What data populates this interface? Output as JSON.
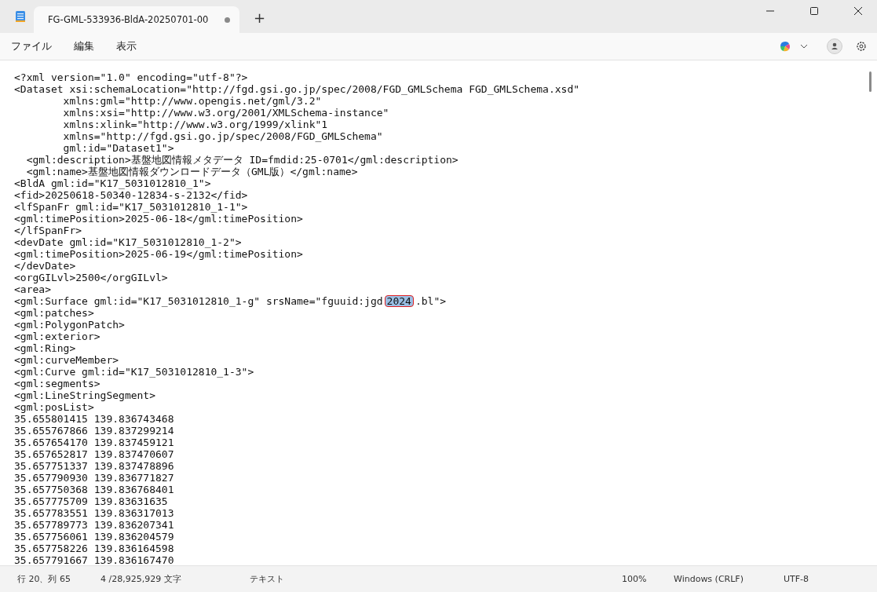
{
  "tab": {
    "title": "FG-GML-533936-BldA-20250701-00",
    "modified": true,
    "new_tab": "+"
  },
  "menu": [
    "ファイル",
    "編集",
    "表示"
  ],
  "lines": [
    {
      "kind": "plain",
      "text": "<?xml version=\"1.0\" encoding=\"utf-8\"?>"
    },
    {
      "kind": "plain",
      "text": "<Dataset xsi:schemaLocation=\"http://fgd.gsi.go.jp/spec/2008/FGD_GMLSchema FGD_GMLSchema.xsd\""
    },
    {
      "kind": "plain",
      "text": "        xmlns:gml=\"http://www.opengis.net/gml/3.2\""
    },
    {
      "kind": "plain",
      "text": "        xmlns:xsi=\"http://www.w3.org/2001/XMLSchema-instance\""
    },
    {
      "kind": "plain",
      "text": "        xmlns:xlink=\"http://www.w3.org/1999/xlink\"1"
    },
    {
      "kind": "plain",
      "text": "        xmlns=\"http://fgd.gsi.go.jp/spec/2008/FGD_GMLSchema\""
    },
    {
      "kind": "plain",
      "text": "        gml:id=\"Dataset1\">"
    },
    {
      "kind": "plain",
      "text": "  <gml:description>基盤地図情報メタデータ ID=fmdid:25-0701</gml:description>"
    },
    {
      "kind": "plain",
      "text": "  <gml:name>基盤地図情報ダウンロードデータ（GML版）</gml:name>"
    },
    {
      "kind": "plain",
      "text": "<BldA gml:id=\"K17_5031012810_1\">"
    },
    {
      "kind": "plain",
      "text": "<fid>20250618-50340-12834-s-2132</fid>"
    },
    {
      "kind": "plain",
      "text": "<lfSpanFr gml:id=\"K17_5031012810_1-1\">"
    },
    {
      "kind": "plain",
      "text": "<gml:timePosition>2025-06-18</gml:timePosition>"
    },
    {
      "kind": "plain",
      "text": "</lfSpanFr>"
    },
    {
      "kind": "plain",
      "text": "<devDate gml:id=\"K17_5031012810_1-2\">"
    },
    {
      "kind": "plain",
      "text": "<gml:timePosition>2025-06-19</gml:timePosition>"
    },
    {
      "kind": "plain",
      "text": "</devDate>"
    },
    {
      "kind": "plain",
      "text": "<orgGILvl>2500</orgGILvl>"
    },
    {
      "kind": "plain",
      "text": "<area>"
    },
    {
      "kind": "selection",
      "before": "<gml:Surface gml:id=\"K17_5031012810_1-g\" srsName=\"fguuid:jgd",
      "selected": "2024",
      "after": ".bl\">",
      "annotated": true
    },
    {
      "kind": "plain",
      "text": "<gml:patches>"
    },
    {
      "kind": "plain",
      "text": "<gml:PolygonPatch>"
    },
    {
      "kind": "plain",
      "text": "<gml:exterior>"
    },
    {
      "kind": "plain",
      "text": "<gml:Ring>"
    },
    {
      "kind": "plain",
      "text": "<gml:curveMember>"
    },
    {
      "kind": "plain",
      "text": "<gml:Curve gml:id=\"K17_5031012810_1-3\">"
    },
    {
      "kind": "plain",
      "text": "<gml:segments>"
    },
    {
      "kind": "plain",
      "text": "<gml:LineStringSegment>"
    },
    {
      "kind": "plain",
      "text": "<gml:posList>"
    },
    {
      "kind": "plain",
      "text": "35.655801415 139.836743468"
    },
    {
      "kind": "plain",
      "text": "35.655767866 139.837299214"
    },
    {
      "kind": "plain",
      "text": "35.657654170 139.837459121"
    },
    {
      "kind": "plain",
      "text": "35.657652817 139.837470607"
    },
    {
      "kind": "plain",
      "text": "35.657751337 139.837478896"
    },
    {
      "kind": "plain",
      "text": "35.657790930 139.836771827"
    },
    {
      "kind": "plain",
      "text": "35.657750368 139.836768401"
    },
    {
      "kind": "plain",
      "text": "35.657775709 139.83631635"
    },
    {
      "kind": "plain",
      "text": "35.657783551 139.836317013"
    },
    {
      "kind": "plain",
      "text": "35.657789773 139.836207341"
    },
    {
      "kind": "plain",
      "text": "35.657756061 139.836204579"
    },
    {
      "kind": "plain",
      "text": "35.657758226 139.836164598"
    },
    {
      "kind": "plain",
      "text": "35.657791667 139.836167470"
    }
  ],
  "status_bar": {
    "position": "行 20、列 65",
    "characters": "4 /28,925,929 文字",
    "format": "テキスト",
    "zoom": "100%",
    "line_ending": "Windows (CRLF)",
    "encoding": "UTF-8"
  }
}
